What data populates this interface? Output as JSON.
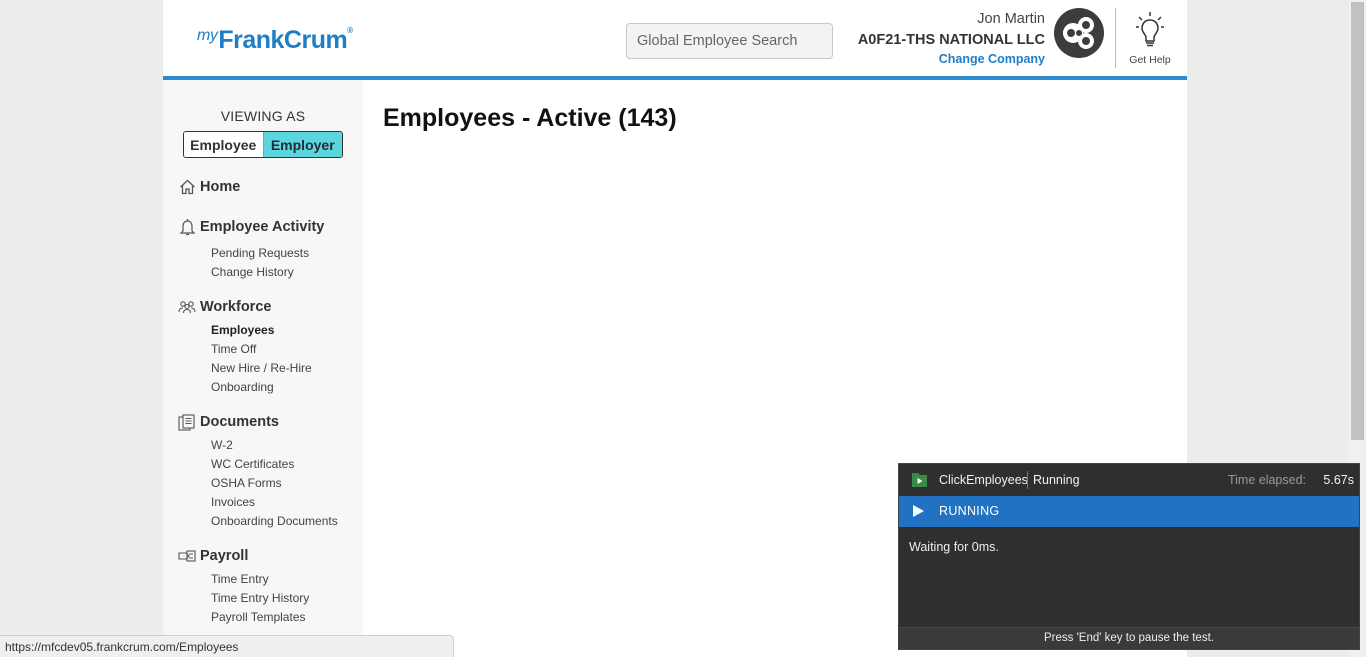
{
  "header": {
    "logo_prefix": "my",
    "logo_text": "FrankCrum",
    "logo_mark": "®",
    "search_placeholder": "Global Employee Search",
    "user_name": "Jon Martin",
    "company_name": "A0F21-THS NATIONAL LLC",
    "change_company_label": "Change Company",
    "help_label": "Get Help",
    "accent_color": "#2b8ccd"
  },
  "sidebar": {
    "viewing_as_label": "VIEWING AS",
    "toggle": {
      "employee_label": "Employee",
      "employer_label": "Employer",
      "selected": "Employer"
    },
    "sections": [
      {
        "label": "Home",
        "icon": "home-icon",
        "items": []
      },
      {
        "label": "Employee Activity",
        "icon": "bell-icon",
        "items": [
          "Pending Requests",
          "Change History"
        ]
      },
      {
        "label": "Workforce",
        "icon": "people-icon",
        "items": [
          "Employees",
          "Time Off",
          "New Hire / Re-Hire",
          "Onboarding"
        ],
        "active_item": "Employees"
      },
      {
        "label": "Documents",
        "icon": "documents-icon",
        "items": [
          "W-2",
          "WC Certificates",
          "OSHA Forms",
          "Invoices",
          "Onboarding Documents"
        ]
      },
      {
        "label": "Payroll",
        "icon": "payroll-icon",
        "items": [
          "Time Entry",
          "Time Entry History",
          "Payroll Templates"
        ]
      }
    ]
  },
  "main": {
    "title": "Employees - Active (143)"
  },
  "status_bar": {
    "url": "https://mfcdev05.frankcrum.com/Employees"
  },
  "test_runner": {
    "test_name": "ClickEmployees",
    "state": "Running",
    "time_label": "Time elapsed:",
    "time_value": "5.67s",
    "bar_label": "RUNNING",
    "message": "Waiting for 0ms.",
    "footer": "Press 'End' key to pause the test.",
    "bar_color": "#2272c3"
  }
}
